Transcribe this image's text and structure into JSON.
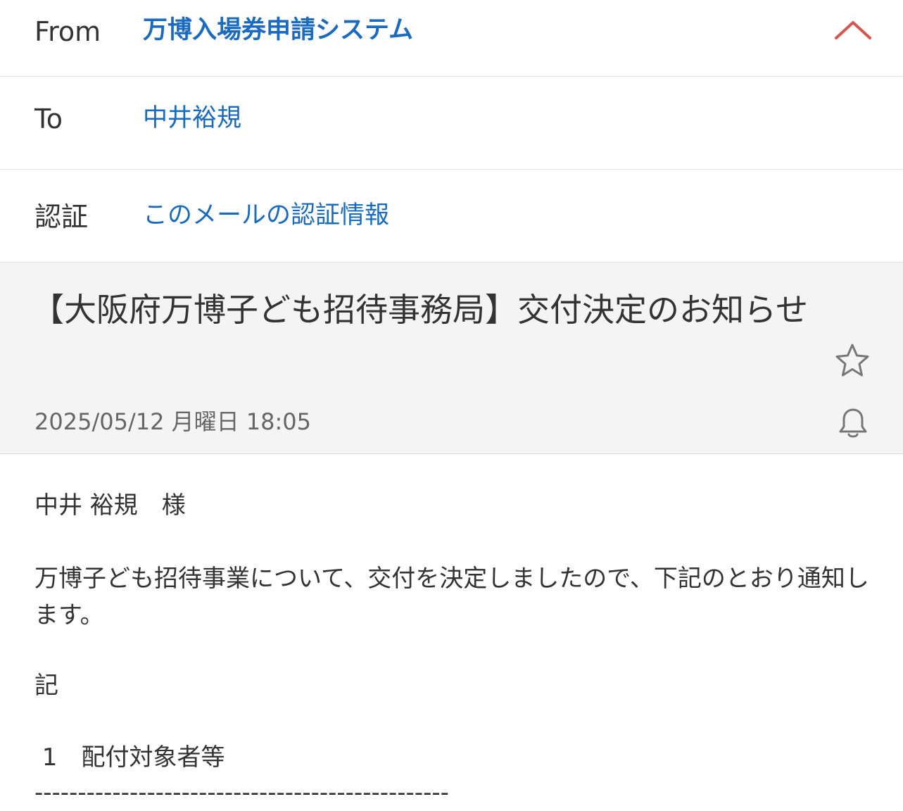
{
  "header": {
    "from_label": "From",
    "from_value": "万博入場券申請システム",
    "to_label": "To",
    "to_value": "中井裕規",
    "auth_label": "認証",
    "auth_value": "このメールの認証情報",
    "collapse_icon": "chevron-up-icon"
  },
  "message": {
    "subject": "【大阪府万博子ども招待事務局】交付決定のお知らせ",
    "date": "2025/05/12 月曜日 18:05",
    "star_icon": "star-icon",
    "bell_icon": "bell-icon"
  },
  "body": {
    "greeting": "中井 裕規　様",
    "paragraph": "万博子ども招待事業について、交付を決定しましたので、下記のとおり通知します。",
    "ki": "記",
    "item1": " 1　配付対象者等",
    "divider": "------------------------------------------------"
  },
  "colors": {
    "link": "#1a6bbf",
    "accent_chevron": "#d9534f",
    "subject_bg": "#f4f4f4"
  }
}
